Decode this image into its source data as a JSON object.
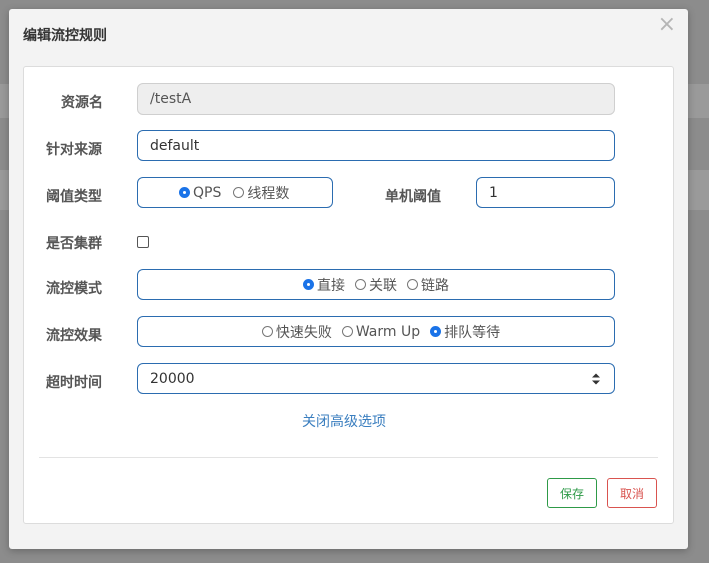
{
  "dialog": {
    "title": "编辑流控规则",
    "close_symbol": "×",
    "close_icon": "close-icon"
  },
  "form": {
    "resource": {
      "label": "资源名",
      "value": "/testA"
    },
    "limit_app": {
      "label": "针对来源",
      "value": "default"
    },
    "grade": {
      "label": "阈值类型",
      "options": [
        {
          "label": "QPS",
          "selected": true
        },
        {
          "label": "线程数",
          "selected": false
        }
      ]
    },
    "count": {
      "label": "单机阈值",
      "value": "1"
    },
    "cluster": {
      "label": "是否集群",
      "checked": false
    },
    "strategy": {
      "label": "流控模式",
      "options": [
        {
          "label": "直接",
          "selected": true
        },
        {
          "label": "关联",
          "selected": false
        },
        {
          "label": "链路",
          "selected": false
        }
      ]
    },
    "control_behavior": {
      "label": "流控效果",
      "options": [
        {
          "label": "快速失败",
          "selected": false
        },
        {
          "label": "Warm Up",
          "selected": false
        },
        {
          "label": "排队等待",
          "selected": true
        }
      ]
    },
    "timeout": {
      "label": "超时时间",
      "value": "20000"
    },
    "advanced_toggle": "关闭高级选项"
  },
  "footer": {
    "save_label": "保存",
    "cancel_label": "取消"
  },
  "colors": {
    "accent": "#1a73e8",
    "input_border": "#2b6cb0",
    "link": "#3a7ebf",
    "save": "#2e9a48",
    "cancel": "#d9534f"
  }
}
